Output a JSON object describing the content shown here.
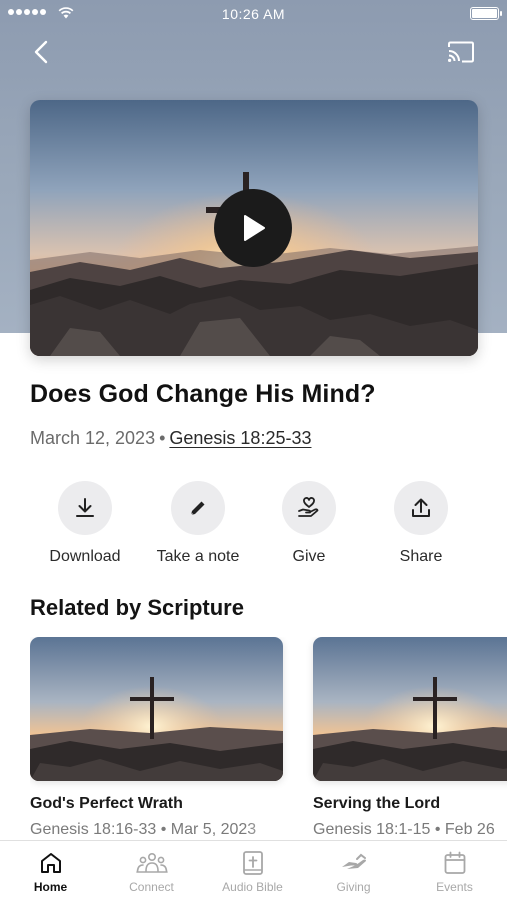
{
  "status_bar": {
    "time": "10:26 AM"
  },
  "nav": {
    "back_icon": "chevron-left-icon",
    "cast_icon": "cast-icon"
  },
  "video": {
    "play_icon": "play-icon"
  },
  "sermon": {
    "title": "Does God Change His Mind?",
    "date": "March 12, 2023",
    "separator": "•",
    "scripture": "Genesis 18:25-33"
  },
  "actions": [
    {
      "label": "Download",
      "icon": "download-icon"
    },
    {
      "label": "Take a note",
      "icon": "pencil-icon"
    },
    {
      "label": "Give",
      "icon": "heart-hand-icon"
    },
    {
      "label": "Share",
      "icon": "share-icon"
    }
  ],
  "related": {
    "title": "Related by Scripture",
    "items": [
      {
        "title": "God's Perfect Wrath",
        "meta": "Genesis 18:16-33 • Mar 5, 2023"
      },
      {
        "title": "Serving the Lord",
        "meta": "Genesis 18:1-15 • Feb 26"
      }
    ]
  },
  "tabs": [
    {
      "label": "Home",
      "icon": "home-icon",
      "active": true
    },
    {
      "label": "Connect",
      "icon": "people-icon",
      "active": false
    },
    {
      "label": "Audio Bible",
      "icon": "bible-icon",
      "active": false
    },
    {
      "label": "Giving",
      "icon": "giving-hand-icon",
      "active": false
    },
    {
      "label": "Events",
      "icon": "calendar-icon",
      "active": false
    }
  ],
  "colors": {
    "hero_background": "#9aa8ba",
    "active_tab": "#111111",
    "inactive_tab": "#a8a8a8",
    "action_circle": "#ececee"
  }
}
